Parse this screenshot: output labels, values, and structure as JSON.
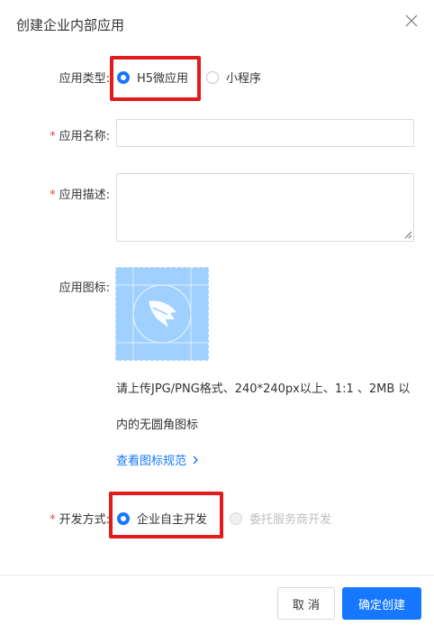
{
  "dialog": {
    "title": "创建企业内部应用"
  },
  "form": {
    "app_type": {
      "label": "应用类型:",
      "options": [
        {
          "label": "H5微应用",
          "selected": true
        },
        {
          "label": "小程序",
          "selected": false
        }
      ]
    },
    "app_name": {
      "label": "应用名称:",
      "value": "",
      "placeholder": ""
    },
    "app_desc": {
      "label": "应用描述:",
      "value": "",
      "placeholder": ""
    },
    "app_icon": {
      "label": "应用图标:",
      "help_line1": "请上传JPG/PNG格式、240*240px以上、1:1 、2MB 以",
      "help_line2": "内的无圆角图标",
      "link": "查看图标规范",
      "link_chevron": ">"
    },
    "dev_mode": {
      "label": "开发方式:",
      "options": [
        {
          "label": "企业自主开发",
          "selected": true,
          "disabled": false
        },
        {
          "label": "委托服务商开发",
          "selected": false,
          "disabled": true
        }
      ]
    },
    "required_mark": "*"
  },
  "footer": {
    "cancel_label": "取 消",
    "confirm_label": "确定创建"
  },
  "colors": {
    "accent": "#1677ff",
    "highlight": "#e21c1c",
    "required": "#e8483b",
    "icon_bg": "#9fd0ff"
  },
  "icons": [
    "close-icon",
    "app-logo-icon",
    "chevron-right-icon"
  ]
}
